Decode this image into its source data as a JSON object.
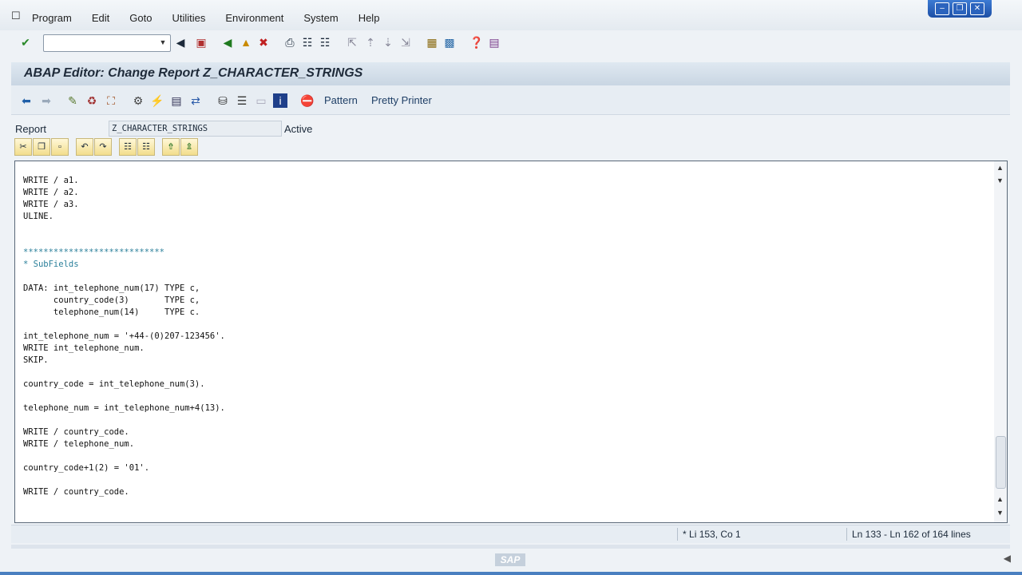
{
  "menubar": {
    "items": [
      "Program",
      "Edit",
      "Goto",
      "Utilities",
      "Environment",
      "System",
      "Help"
    ]
  },
  "title": "ABAP Editor: Change Report Z_CHARACTER_STRINGS",
  "app_toolbar": {
    "pattern_label": "Pattern",
    "pretty_printer_label": "Pretty Printer"
  },
  "report": {
    "label": "Report",
    "value": "Z_CHARACTER_STRINGS",
    "status": "Active"
  },
  "code_lines": [
    "WRITE / a1.",
    "WRITE / a2.",
    "WRITE / a3.",
    "ULINE.",
    "",
    "",
    "****************************",
    "* SubFields",
    "",
    "DATA: int_telephone_num(17) TYPE c,",
    "      country_code(3)       TYPE c,",
    "      telephone_num(14)     TYPE c.",
    "",
    "int_telephone_num = '+44-(0)207-123456'.",
    "WRITE int_telephone_num.",
    "SKIP.",
    "",
    "country_code = int_telephone_num(3).",
    "",
    "telephone_num = int_telephone_num+4(13).",
    "",
    "WRITE / country_code.",
    "WRITE / telephone_num.",
    "",
    "country_code+1(2) = '01'.",
    "",
    "WRITE / country_code."
  ],
  "status": {
    "cursor": "Li 153, Co 1",
    "lines": "Ln 133 - Ln 162 of 164 lines",
    "modified_marker": "*"
  },
  "footer": {
    "logo_text": "SAP"
  },
  "colors": {
    "comment": "#2a7f9a",
    "title_bg": "#c9d6e3"
  }
}
